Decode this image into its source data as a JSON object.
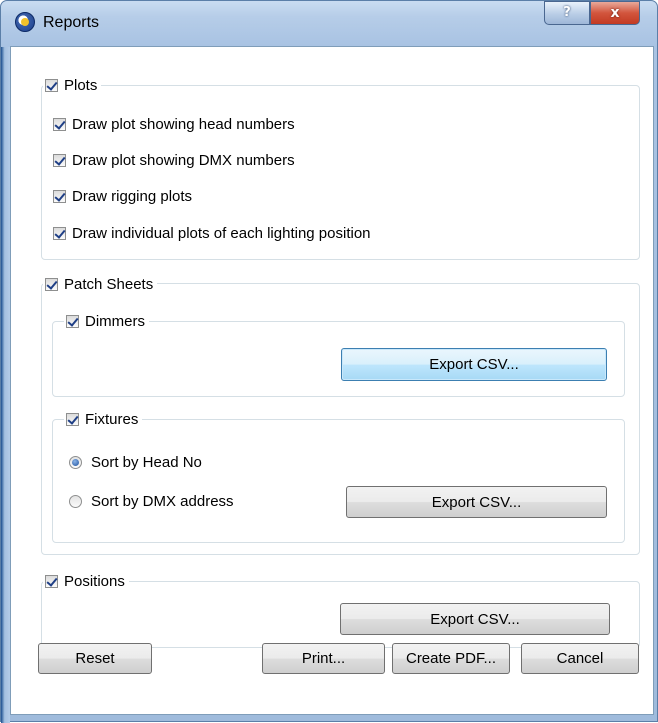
{
  "window": {
    "title": "Reports",
    "help_label": "?",
    "close_label": "x"
  },
  "plots": {
    "label": "Plots",
    "checked": true,
    "options": [
      {
        "label": "Draw plot showing head numbers",
        "checked": true
      },
      {
        "label": "Draw plot showing DMX numbers",
        "checked": true
      },
      {
        "label": "Draw rigging plots",
        "checked": true
      },
      {
        "label": "Draw individual plots of each lighting position",
        "checked": true
      }
    ]
  },
  "patch_sheets": {
    "label": "Patch Sheets",
    "checked": true,
    "dimmers": {
      "label": "Dimmers",
      "checked": true,
      "export_label": "Export CSV..."
    },
    "fixtures": {
      "label": "Fixtures",
      "checked": true,
      "sort_head_label": "Sort by Head No",
      "sort_dmx_label": "Sort by DMX address",
      "selected_sort": "Sort by Head No",
      "export_label": "Export CSV..."
    }
  },
  "positions": {
    "label": "Positions",
    "checked": true,
    "export_label": "Export CSV..."
  },
  "footer": {
    "reset_label": "Reset",
    "print_label": "Print...",
    "create_pdf_label": "Create PDF...",
    "cancel_label": "Cancel"
  }
}
